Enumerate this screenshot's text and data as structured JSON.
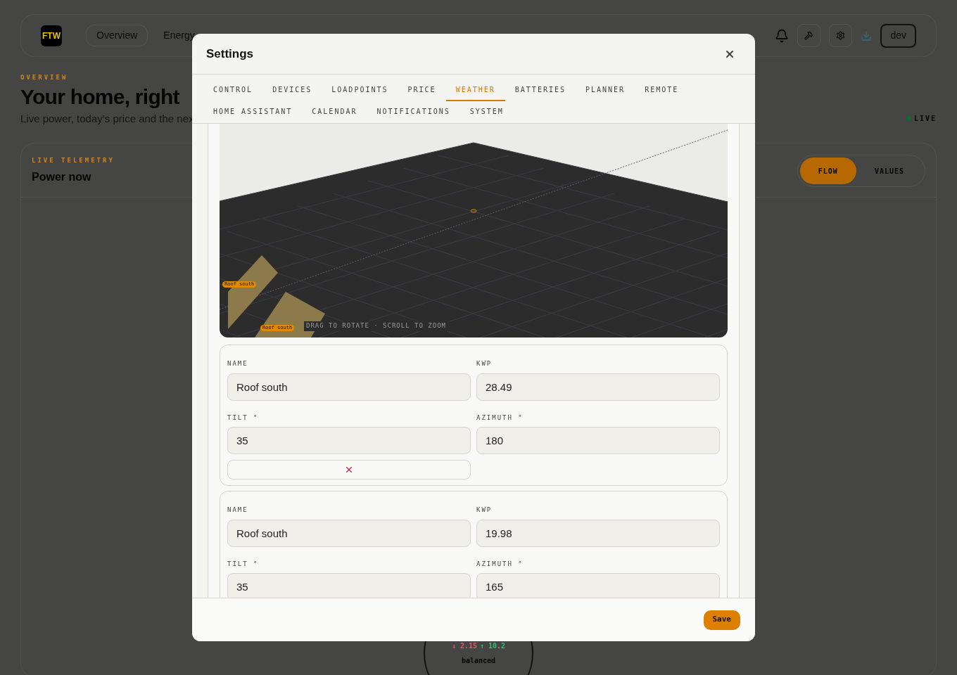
{
  "page": {
    "logo": "FTW",
    "nav": [
      {
        "label": "Overview",
        "selected": true
      },
      {
        "label": "Energy",
        "selected": false
      }
    ],
    "user": "dev",
    "eyebrow": "OVERVIEW",
    "heading": "Your home, right",
    "subtitle": "Live power, today’s price and the nex",
    "live": "LIVE",
    "card": {
      "eyebrow": "LIVE TELEMETRY",
      "title": "Power now",
      "toggle": [
        {
          "label": "FLOW",
          "selected": true
        },
        {
          "label": "VALUES",
          "selected": false
        }
      ]
    },
    "gauge": {
      "import": "↓ 2.15",
      "export": "↑ 10.2",
      "status": "balanced"
    }
  },
  "modal": {
    "title": "Settings",
    "tab_rows": [
      [
        {
          "label": "CONTROL",
          "selected": false
        },
        {
          "label": "DEVICES",
          "selected": false
        },
        {
          "label": "LOADPOINTS",
          "selected": false
        },
        {
          "label": "PRICE",
          "selected": false
        },
        {
          "label": "WEATHER",
          "selected": true
        },
        {
          "label": "BATTERIES",
          "selected": false
        },
        {
          "label": "PLANNER",
          "selected": false
        },
        {
          "label": "REMOTE",
          "selected": false
        }
      ],
      [
        {
          "label": "HOME ASSISTANT",
          "selected": false
        },
        {
          "label": "CALENDAR",
          "selected": false
        },
        {
          "label": "NOTIFICATIONS",
          "selected": false
        },
        {
          "label": "SYSTEM",
          "selected": false
        }
      ]
    ],
    "scene": {
      "hint": "DRAG TO ROTATE · SCROLL TO ZOOM",
      "panels": [
        "Roof south",
        "Roof south"
      ]
    },
    "arrays": [
      {
        "fields": [
          {
            "label": "NAME",
            "value": "Roof south"
          },
          {
            "label": "KWP",
            "value": "28.49"
          },
          {
            "label": "TILT °",
            "value": "35"
          },
          {
            "label": "AZIMUTH °",
            "value": "180"
          }
        ],
        "action": {
          "kind": "remove"
        }
      },
      {
        "fields": [
          {
            "label": "NAME",
            "value": "Roof south"
          },
          {
            "label": "KWP",
            "value": "19.98"
          },
          {
            "label": "TILT °",
            "value": "35"
          },
          {
            "label": "AZIMUTH °",
            "value": "165"
          }
        ]
      }
    ],
    "save": "Save"
  }
}
